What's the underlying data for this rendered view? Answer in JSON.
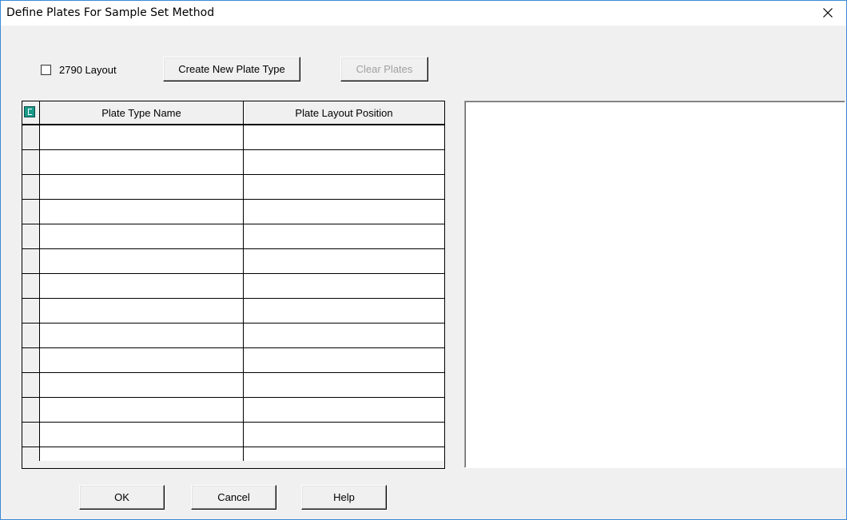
{
  "window": {
    "title": "Define Plates For Sample Set Method",
    "close_icon": "close-icon"
  },
  "options": {
    "layout_2790_label": "2790 Layout",
    "layout_2790_checked": false
  },
  "toolbar": {
    "create_new_plate_type_label": "Create New Plate Type",
    "clear_plates_label": "Clear Plates"
  },
  "grid": {
    "corner_icon": "grid-select-all-icon",
    "columns": [
      "Plate Type Name",
      "Plate Layout Position"
    ],
    "rows": [
      [
        "",
        ""
      ],
      [
        "",
        ""
      ],
      [
        "",
        ""
      ],
      [
        "",
        ""
      ],
      [
        "",
        ""
      ],
      [
        "",
        ""
      ],
      [
        "",
        ""
      ],
      [
        "",
        ""
      ],
      [
        "",
        ""
      ],
      [
        "",
        ""
      ],
      [
        "",
        ""
      ],
      [
        "",
        ""
      ],
      [
        "",
        ""
      ],
      [
        "",
        ""
      ]
    ]
  },
  "footer": {
    "ok_label": "OK",
    "cancel_label": "Cancel",
    "help_label": "Help"
  }
}
